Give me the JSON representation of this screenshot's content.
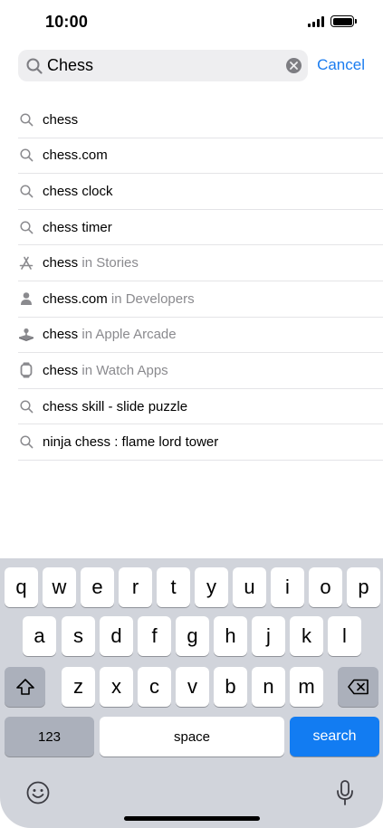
{
  "status_bar": {
    "time": "10:00",
    "icons": [
      "cellular-signal-icon",
      "battery-icon"
    ]
  },
  "search": {
    "value": "Chess",
    "placeholder": "",
    "cancel_label": "Cancel"
  },
  "suggestions": [
    {
      "icon": "search-icon",
      "term": "chess",
      "scope": ""
    },
    {
      "icon": "search-icon",
      "term": "chess.com",
      "scope": ""
    },
    {
      "icon": "search-icon",
      "term": "chess clock",
      "scope": ""
    },
    {
      "icon": "search-icon",
      "term": "chess timer",
      "scope": ""
    },
    {
      "icon": "app-store-icon",
      "term": "chess",
      "scope": " in Stories"
    },
    {
      "icon": "person-icon",
      "term": "chess.com",
      "scope": " in Developers"
    },
    {
      "icon": "arcade-joystick-icon",
      "term": "chess",
      "scope": " in Apple Arcade"
    },
    {
      "icon": "watch-icon",
      "term": "chess",
      "scope": " in Watch Apps"
    },
    {
      "icon": "search-icon",
      "term": "chess skill - slide puzzle",
      "scope": ""
    },
    {
      "icon": "search-icon",
      "term": "ninja chess : flame lord tower",
      "scope": ""
    }
  ],
  "keyboard": {
    "row1": [
      "q",
      "w",
      "e",
      "r",
      "t",
      "y",
      "u",
      "i",
      "o",
      "p"
    ],
    "row2": [
      "a",
      "s",
      "d",
      "f",
      "g",
      "h",
      "j",
      "k",
      "l"
    ],
    "row3": [
      "z",
      "x",
      "c",
      "v",
      "b",
      "n",
      "m"
    ],
    "numbers_label": "123",
    "space_label": "space",
    "search_label": "search",
    "accent_color": "#127cf2"
  },
  "colors": {
    "link": "#1a7cf0",
    "scope_text": "#8a8a8e",
    "keyboard_bg": "#d1d4db"
  }
}
